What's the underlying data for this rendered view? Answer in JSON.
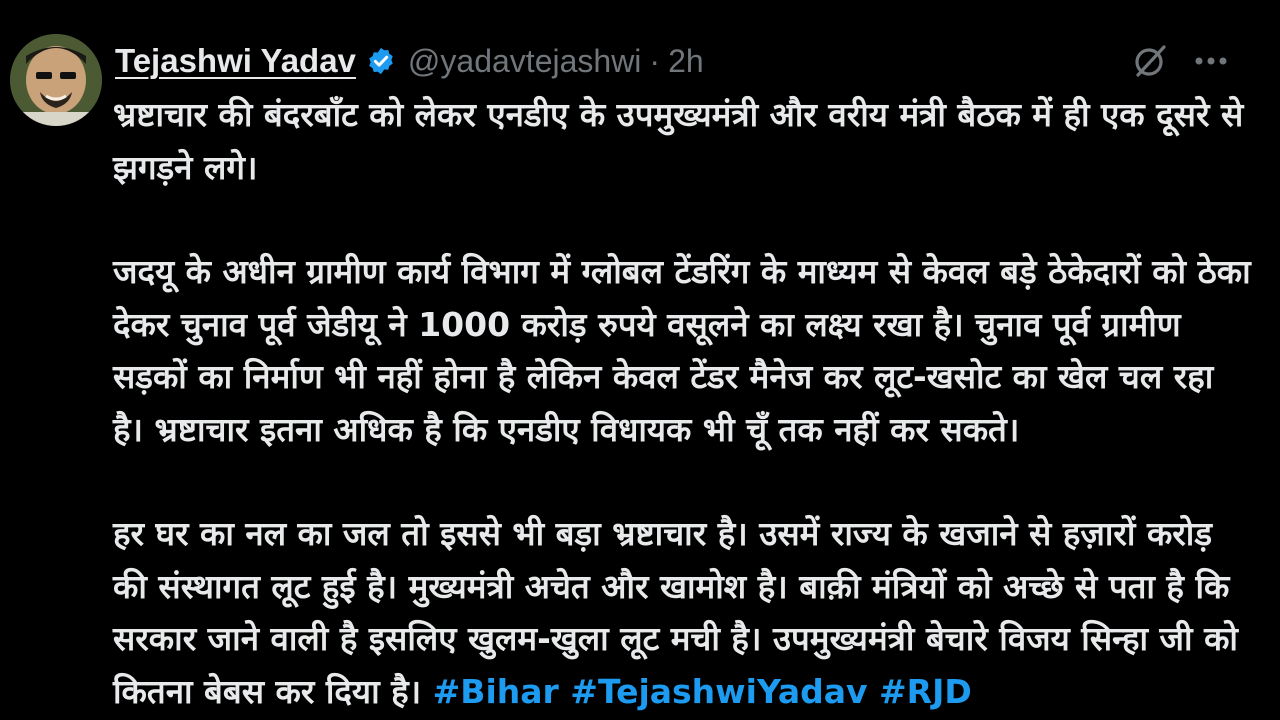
{
  "author": {
    "name": "Tejashwi Yadav",
    "handle": "@yadavtejashwi",
    "separator": "·",
    "time": "2h",
    "verified_color": "#1d9bf0"
  },
  "toolbar": {
    "icons": [
      "grok-icon",
      "more-icon"
    ]
  },
  "tweet": {
    "paragraphs": [
      "भ्रष्टाचार की बंदरबाँट को लेकर एनडीए के उपमुख्यमंत्री और वरीय मंत्री बैठक में ही एक दूसरे से झगड़ने लगे।",
      "जदयू के अधीन ग्रामीण कार्य विभाग में ग्लोबल टेंडरिंग के माध्यम से केवल बड़े ठेकेदारों को ठेका देकर चुनाव पूर्व जेडीयू ने 1000 करोड़ रुपये वसूलने का लक्ष्य रखा है। चुनाव पूर्व ग्रामीण सड़कों का निर्माण भी नहीं होना है लेकिन केवल टेंडर मैनेज कर लूट-खसोट का खेल चल रहा है। भ्रष्टाचार इतना अधिक है कि एनडीए विधायक भी चूँ तक नहीं कर सकते।",
      "हर घर का नल का जल तो इससे भी बड़ा भ्रष्टाचार है। उसमें राज्य के खजाने से हज़ारों करोड़ की संस्थागत लूट हुई है। मुख्यमंत्री अचेत और खामोश है। बाक़ी मंत्रियों को अच्छे से पता है कि सरकार जाने वाली है इसलिए खुलम-खुला लूट मची है। उपमुख्यमंत्री बेचारे विजय सिन्हा जी को कितना बेबस कर दिया है।"
    ],
    "hashtags": [
      "#Bihar",
      "#TejashwiYadav",
      "#RJD"
    ]
  },
  "colors": {
    "background": "#000000",
    "text": "#e7e9ea",
    "muted": "#71767b",
    "link": "#1d9bf0"
  }
}
